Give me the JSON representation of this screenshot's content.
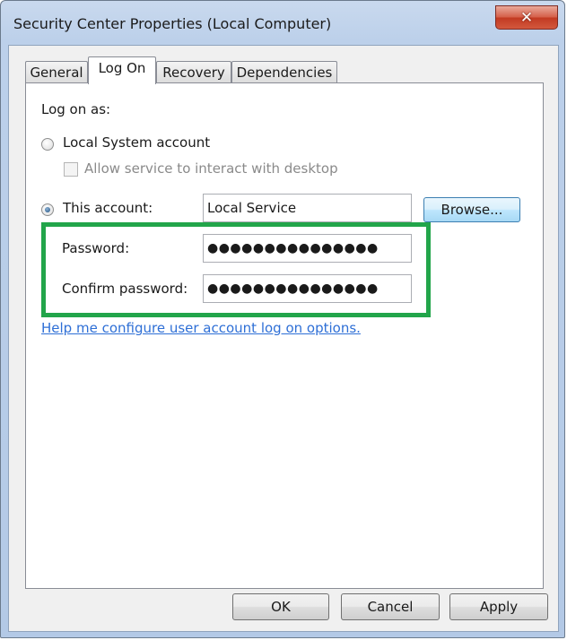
{
  "window": {
    "title": "Security Center Properties (Local Computer)",
    "close_label": "✕"
  },
  "tabs": [
    {
      "label": "General",
      "active": false
    },
    {
      "label": "Log On",
      "active": true
    },
    {
      "label": "Recovery",
      "active": false
    },
    {
      "label": "Dependencies",
      "active": false
    }
  ],
  "logon": {
    "heading": "Log on as:",
    "local_system_label": "Local System account",
    "interact_label": "Allow service to interact with desktop",
    "this_account_label": "This account:",
    "account_value": "Local Service",
    "browse_label": "Browse...",
    "password_label": "Password:",
    "password_value": "●●●●●●●●●●●●●●●",
    "confirm_label": "Confirm password:",
    "confirm_value": "●●●●●●●●●●●●●●●",
    "help_link": "Help me configure user account log on options.",
    "highlight_color": "#22a54a"
  },
  "footer": {
    "ok_label": "OK",
    "cancel_label": "Cancel",
    "apply_label": "Apply"
  }
}
